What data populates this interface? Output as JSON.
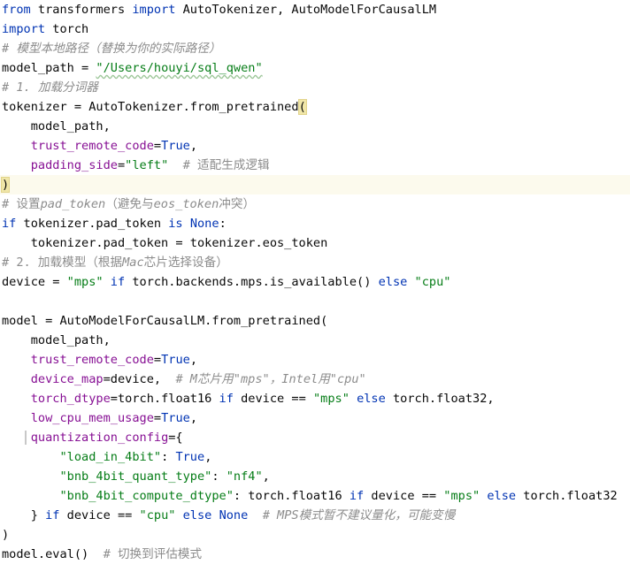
{
  "lines": {
    "l1": [
      "from",
      " transformers ",
      "import",
      " AutoTokenizer, AutoModelForCausalLM"
    ],
    "l2": [
      "import",
      " torch"
    ],
    "l3": [
      "# 模型本地路径（替换为你的实际路径）"
    ],
    "l4": [
      "model_path = ",
      "\"/Users/houyi/sql_qwen\""
    ],
    "l5": [
      "# 1. 加载分词器"
    ],
    "l6": [
      "tokenizer = AutoTokenizer.from_pretrained",
      "("
    ],
    "l7": [
      "    model_path,"
    ],
    "l8": [
      "    ",
      "trust_remote_code",
      "=",
      "True",
      ","
    ],
    "l9": [
      "    ",
      "padding_side",
      "=",
      "\"left\"",
      "  ",
      "# 适配生成逻辑"
    ],
    "l10": [
      ")"
    ],
    "l11": [
      "# 设置",
      "pad_token",
      "（避免与",
      "eos_token",
      "冲突）"
    ],
    "l12": [
      "if",
      " tokenizer.pad_token ",
      "is",
      " ",
      "None",
      ":"
    ],
    "l13": [
      "    tokenizer.pad_token = tokenizer.eos_token"
    ],
    "l14": [
      "# 2. 加载模型（根据",
      "Mac",
      "芯片选择设备）"
    ],
    "l15": [
      "device = ",
      "\"mps\"",
      " ",
      "if",
      " torch.backends.mps.is_available() ",
      "else",
      " ",
      "\"cpu\""
    ],
    "l16": [
      ""
    ],
    "l17": [
      "model = AutoModelForCausalLM.from_pretrained("
    ],
    "l18": [
      "    model_path,"
    ],
    "l19": [
      "    ",
      "trust_remote_code",
      "=",
      "True",
      ","
    ],
    "l20": [
      "    ",
      "device_map",
      "=device,  ",
      "# M芯片用\"mps\"，Intel用\"cpu\""
    ],
    "l21": [
      "    ",
      "torch_dtype",
      "=torch.float16 ",
      "if",
      " device == ",
      "\"mps\"",
      " ",
      "else",
      " torch.float32,"
    ],
    "l22": [
      "    ",
      "low_cpu_mem_usage",
      "=",
      "True",
      ","
    ],
    "l23": [
      "    ",
      "quantization_config",
      "={"
    ],
    "l24": [
      "        ",
      "\"load_in_4bit\"",
      ": ",
      "True",
      ","
    ],
    "l25": [
      "        ",
      "\"bnb_4bit_quant_type\"",
      ": ",
      "\"nf4\"",
      ","
    ],
    "l26": [
      "        ",
      "\"bnb_4bit_compute_dtype\"",
      ": torch.float16 ",
      "if",
      " device == ",
      "\"mps\"",
      " ",
      "else",
      " torch.float32"
    ],
    "l27": [
      "    } ",
      "if",
      " device == ",
      "\"cpu\"",
      " ",
      "else",
      " ",
      "None",
      "  ",
      "# MPS模式暂不建议量化，可能变慢"
    ],
    "l28": [
      ")"
    ],
    "l29": [
      "model.eval()  ",
      "# 切换到评估模式"
    ]
  },
  "colors": {
    "keyword": "#0033b3",
    "string": "#067d17",
    "kwarg": "#871094",
    "comment": "#8c8c8c",
    "current_line": "#fcfaed"
  }
}
